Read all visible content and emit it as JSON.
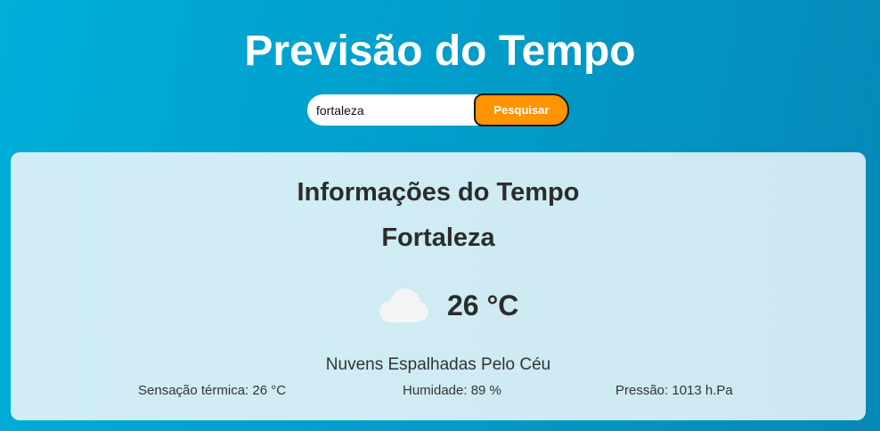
{
  "header": {
    "title": "Previsão do Tempo"
  },
  "search": {
    "value": "fortaleza",
    "button_label": "Pesquisar"
  },
  "weather": {
    "heading": "Informações do Tempo",
    "city": "Fortaleza",
    "icon": "cloud-icon",
    "temperature": "26 °C",
    "description": "Nuvens Espalhadas Pelo Céu",
    "feels_like": "Sensação térmica: 26 °C",
    "humidity": "Humidade: 89 %",
    "pressure": "Pressão: 1013 h.Pa"
  },
  "colors": {
    "accent": "#ff9300",
    "card_background": "#d1eef7",
    "page_gradient_start": "#00aed9",
    "page_gradient_end": "#0688b8"
  }
}
